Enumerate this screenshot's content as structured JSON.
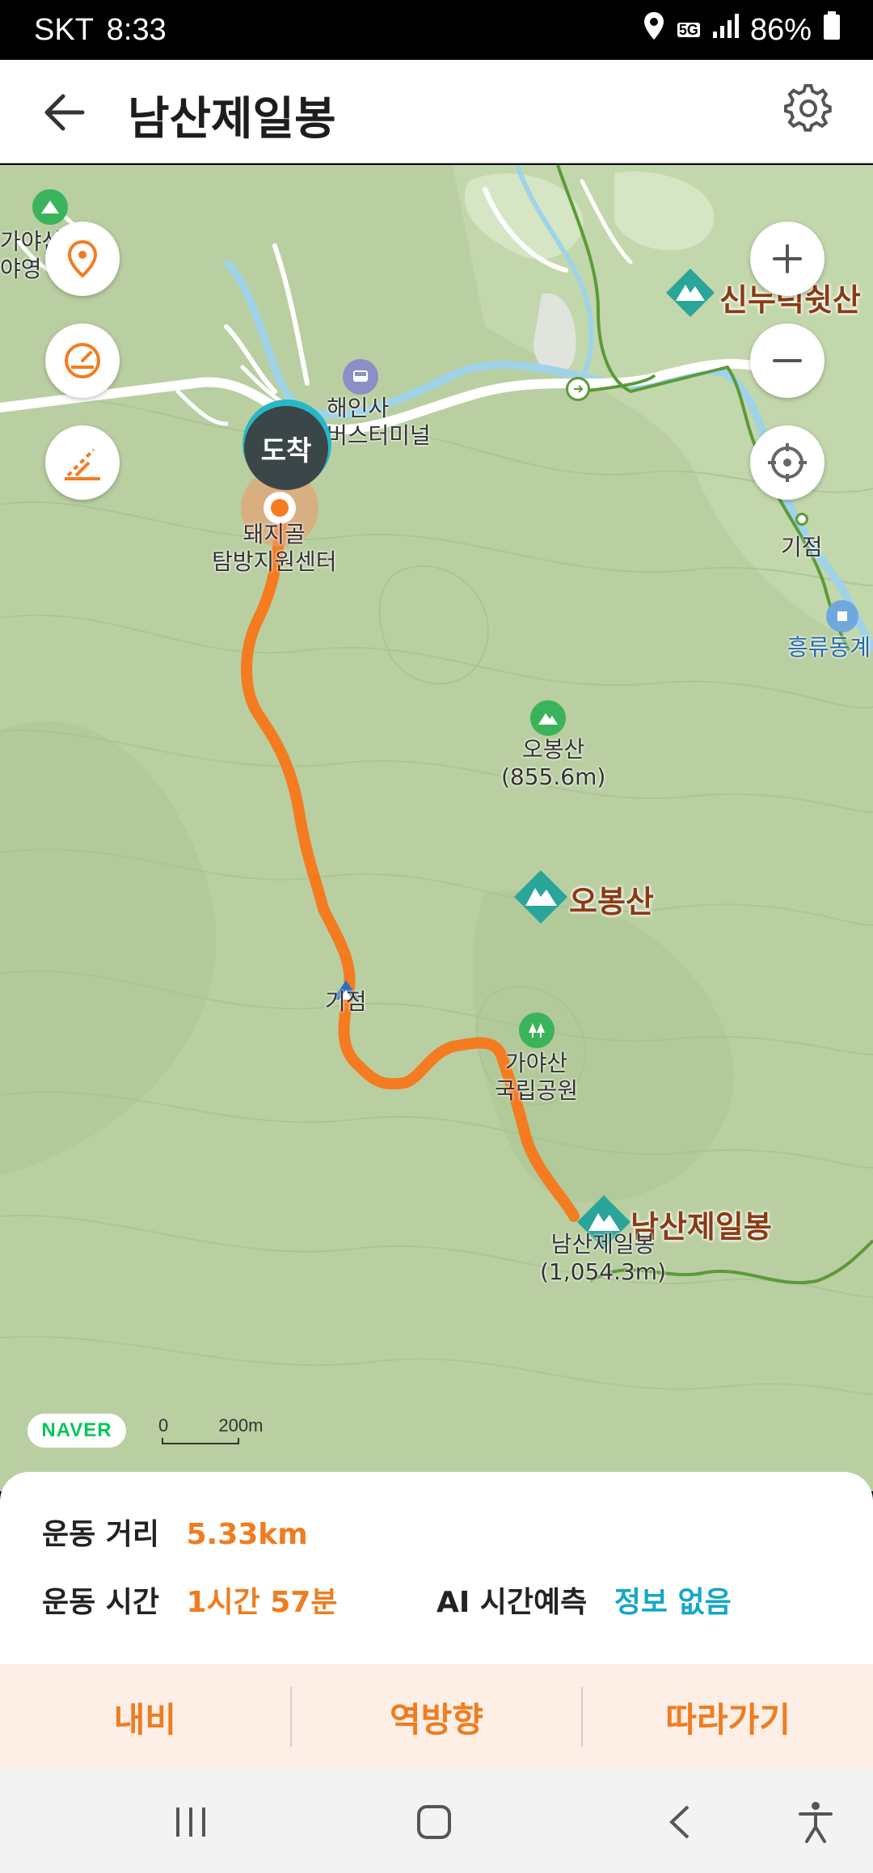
{
  "status": {
    "carrier": "SKT",
    "time": "8:33",
    "network": "5G",
    "battery": "86%"
  },
  "header": {
    "title": "남산제일봉"
  },
  "map": {
    "arrival_label": "도착",
    "labels": {
      "gayasan_top": "가야산\n야영",
      "haeinsa_terminal": "해인사\n버스터미널",
      "start_point": "돼지골\n탐방지원센터",
      "obongsan_small": "오봉산\n(855.6m)",
      "national_park": "가야산\n국립공원",
      "namsan_small": "남산제일봉\n(1,054.3m)",
      "gijeom_right": "기점",
      "gijeom_mid": "기점",
      "heungryu": "흥류동계"
    },
    "peaks": {
      "sinbul": "신누럭쉿산",
      "obongsan": "오봉산",
      "namsan": "남산제일봉"
    },
    "naver": "NAVER",
    "scale_zero": "0",
    "scale_label": "200m",
    "colors": {
      "route": "#f47b20",
      "map_bg": "#b9cfa1",
      "peak_icon": "#2aa59a"
    }
  },
  "info": {
    "distance_key": "운동 거리",
    "distance_val": "5.33km",
    "time_key": "운동 시간",
    "time_val": "1시간 57분",
    "ai_key": "AI 시간예측",
    "ai_val": "정보 없음"
  },
  "actions": {
    "navi": "내비",
    "reverse": "역방향",
    "follow": "따라가기"
  }
}
